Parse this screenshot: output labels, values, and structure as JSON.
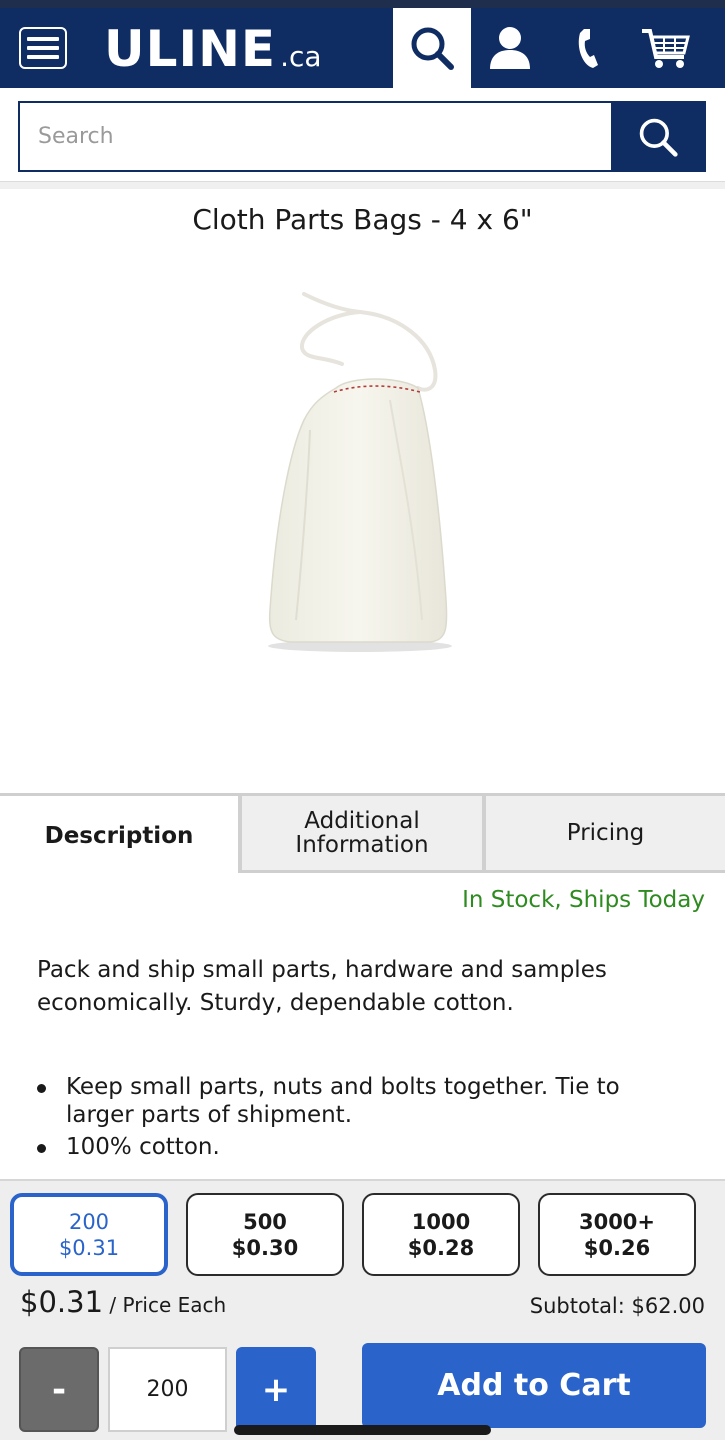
{
  "header": {
    "logo_main": "ULINE",
    "logo_tld": ".ca",
    "icons": [
      "menu-icon",
      "search-icon",
      "user-icon",
      "phone-icon",
      "cart-icon"
    ]
  },
  "search": {
    "placeholder": "Search",
    "value": ""
  },
  "product": {
    "title": "Cloth Parts Bags - 4 x 6\"",
    "image": "cloth-drawstring-bag"
  },
  "tabs": [
    {
      "label": "Description",
      "active": true
    },
    {
      "label": "Additional Information",
      "active": false
    },
    {
      "label": "Pricing",
      "active": false
    }
  ],
  "availability": "In Stock, Ships Today",
  "description": "Pack and ship small parts, hardware and samples economically. Sturdy, dependable cotton.",
  "bullets": [
    "Keep small parts, nuts and bolts together. Tie to larger parts of shipment.",
    "100% cotton."
  ],
  "pricing_tiers": [
    {
      "qty": "200",
      "price": "$0.31",
      "selected": true
    },
    {
      "qty": "500",
      "price": "$0.30",
      "selected": false
    },
    {
      "qty": "1000",
      "price": "$0.28",
      "selected": false
    },
    {
      "qty": "3000+",
      "price": "$0.26",
      "selected": false
    }
  ],
  "price_each": "$0.31",
  "price_each_label": " / Price Each",
  "subtotal": "Subtotal: $62.00",
  "quantity": {
    "minus": "-",
    "value": "200",
    "plus": "+"
  },
  "add_to_cart": "Add to Cart",
  "colors": {
    "navy": "#0f2c63",
    "blue": "#2a63c9",
    "stock_green": "#2e8b1f"
  }
}
